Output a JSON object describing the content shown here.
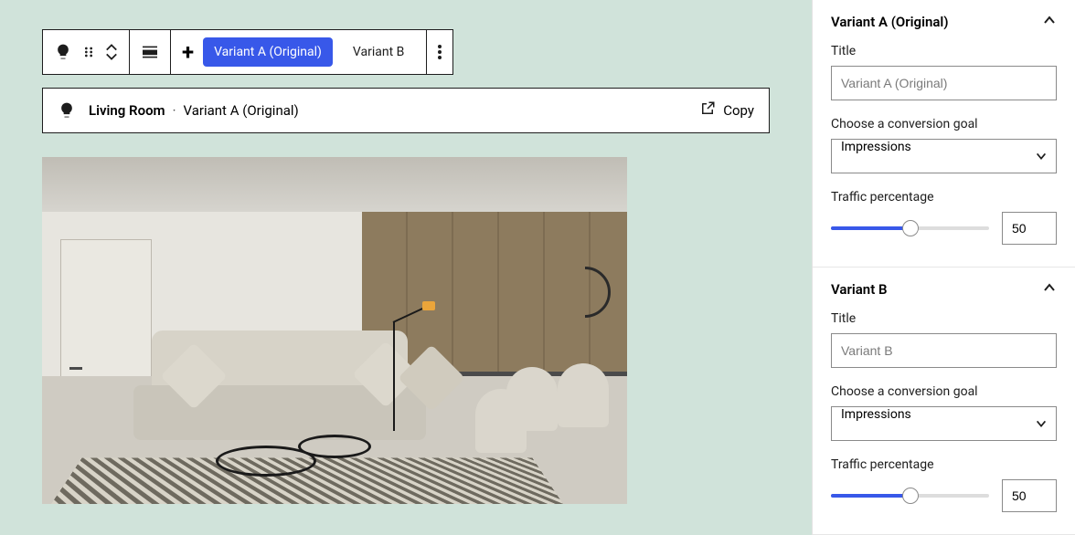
{
  "toolbar": {
    "variant_a_label": "Variant A (Original)",
    "variant_b_label": "Variant B"
  },
  "breadcrumb": {
    "block": "Living Room",
    "variant": "Variant A (Original)",
    "copy_label": "Copy"
  },
  "sidebar": {
    "panel_a": {
      "header": "Variant A (Original)",
      "title_label": "Title",
      "title_placeholder": "Variant A (Original)",
      "goal_label": "Choose a conversion goal",
      "goal_value": "Impressions",
      "traffic_label": "Traffic percentage",
      "traffic_value": "50"
    },
    "panel_b": {
      "header": "Variant B",
      "title_label": "Title",
      "title_placeholder": "Variant B",
      "goal_label": "Choose a conversion goal",
      "goal_value": "Impressions",
      "traffic_label": "Traffic percentage",
      "traffic_value": "50"
    }
  }
}
